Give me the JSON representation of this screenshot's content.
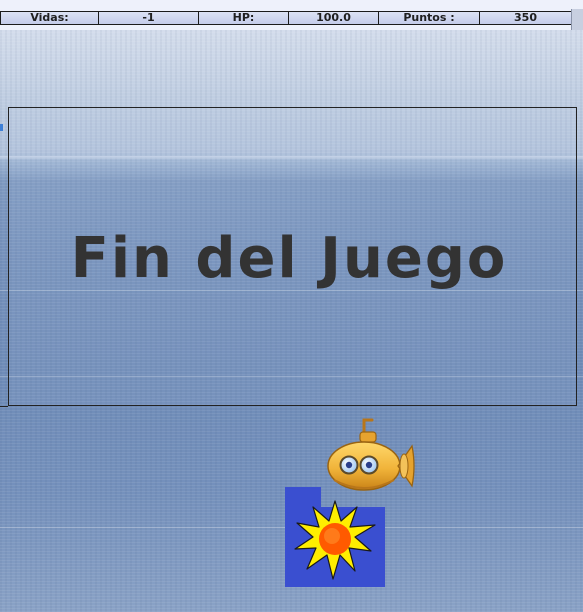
{
  "hud": {
    "lives_label": "Vidas:",
    "lives_value": "-1",
    "hp_label": "HP:",
    "hp_value": "100.0",
    "points_label": "Puntos :",
    "points_value": "350"
  },
  "game_over": {
    "title": "Fin del Juego"
  },
  "sprites": {
    "player": "submarine-icon",
    "effect": "explosion-icon"
  },
  "colors": {
    "title_text": "#333333",
    "explosion_tile": "#3a4fd0",
    "explosion_outer": "#ffee00",
    "explosion_inner": "#ff5a00",
    "submarine_body": "#f1b43a"
  }
}
